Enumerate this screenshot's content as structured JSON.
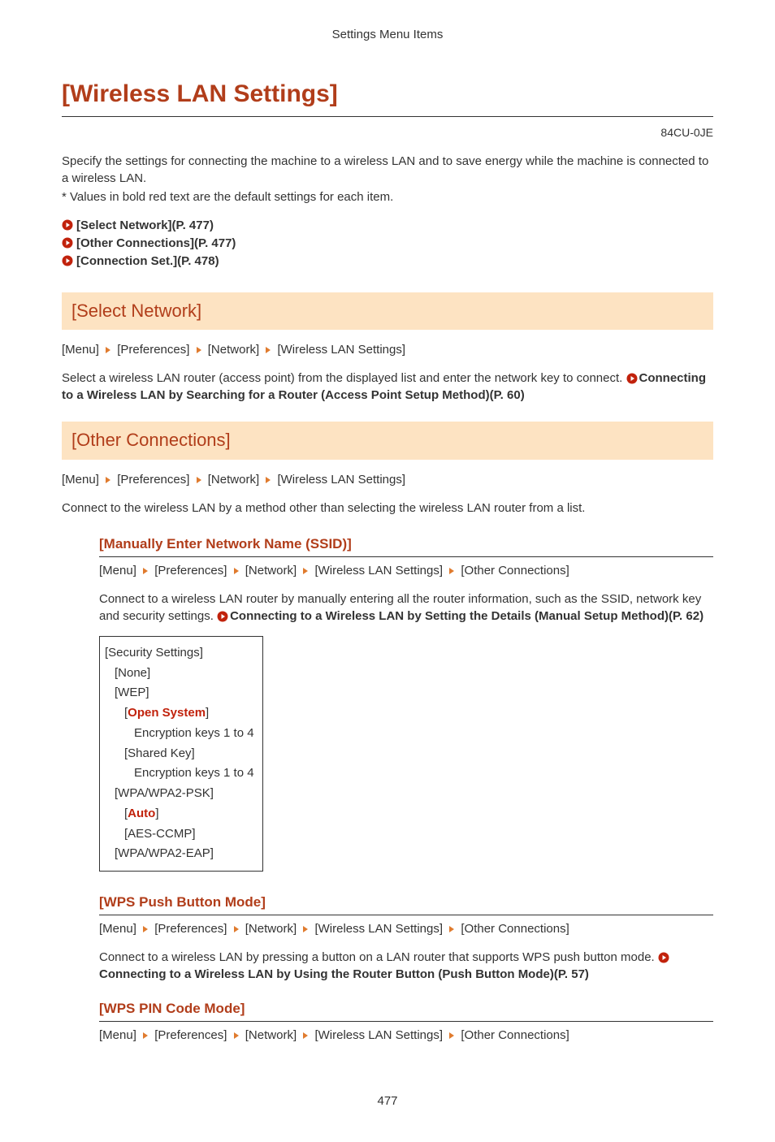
{
  "header": {
    "crumb": "Settings Menu Items"
  },
  "title": "[Wireless LAN Settings]",
  "doc_code": "84CU-0JE",
  "intro": {
    "p1": "Specify the settings for connecting the machine to a wireless LAN and to save energy while the machine is connected to a wireless LAN.",
    "p2": "* Values in bold red text are the default settings for each item."
  },
  "toc": {
    "0": "[Select Network](P. 477)",
    "1": "[Other Connections](P. 477)",
    "2": "[Connection Set.](P. 478)"
  },
  "sec1": {
    "title": "[Select Network]",
    "bc": {
      "0": "[Menu]",
      "1": "[Preferences]",
      "2": "[Network]",
      "3": "[Wireless LAN Settings]"
    },
    "desc": "Select a wireless LAN router (access point) from the displayed list and enter the network key to connect. ",
    "link": "Connecting to a Wireless LAN by Searching for a Router (Access Point Setup Method)(P. 60)"
  },
  "sec2": {
    "title": "[Other Connections]",
    "bc": {
      "0": "[Menu]",
      "1": "[Preferences]",
      "2": "[Network]",
      "3": "[Wireless LAN Settings]"
    },
    "desc": "Connect to the wireless LAN by a method other than selecting the wireless LAN router from a list."
  },
  "sub1": {
    "title": "[Manually Enter Network Name (SSID)]",
    "bc": {
      "0": "[Menu]",
      "1": "[Preferences]",
      "2": "[Network]",
      "3": "[Wireless LAN Settings]",
      "4": "[Other Connections]"
    },
    "desc": "Connect to a wireless LAN router by manually entering all the router information, such as the SSID, network key and security settings. ",
    "link": "Connecting to a Wireless LAN by Setting the Details (Manual Setup Method)(P. 62)",
    "box": {
      "l0": "[Security Settings]",
      "l1": "[None]",
      "l2": "[WEP]",
      "l3a": "[",
      "l3b": "Open System",
      "l3c": "]",
      "l4": "Encryption keys 1 to 4",
      "l5": "[Shared Key]",
      "l6": "Encryption keys 1 to 4",
      "l7": "[WPA/WPA2-PSK]",
      "l8a": "[",
      "l8b": "Auto",
      "l8c": "]",
      "l9": "[AES-CCMP]",
      "l10": "[WPA/WPA2-EAP]"
    }
  },
  "sub2": {
    "title": "[WPS Push Button Mode]",
    "bc": {
      "0": "[Menu]",
      "1": "[Preferences]",
      "2": "[Network]",
      "3": "[Wireless LAN Settings]",
      "4": "[Other Connections]"
    },
    "desc": "Connect to a wireless LAN by pressing a button on a LAN router that supports WPS push button mode. ",
    "link": "Connecting to a Wireless LAN by Using the Router Button (Push Button Mode)(P. 57)"
  },
  "sub3": {
    "title": "[WPS PIN Code Mode]",
    "bc": {
      "0": "[Menu]",
      "1": "[Preferences]",
      "2": "[Network]",
      "3": "[Wireless LAN Settings]",
      "4": "[Other Connections]"
    }
  },
  "page_number": "477"
}
